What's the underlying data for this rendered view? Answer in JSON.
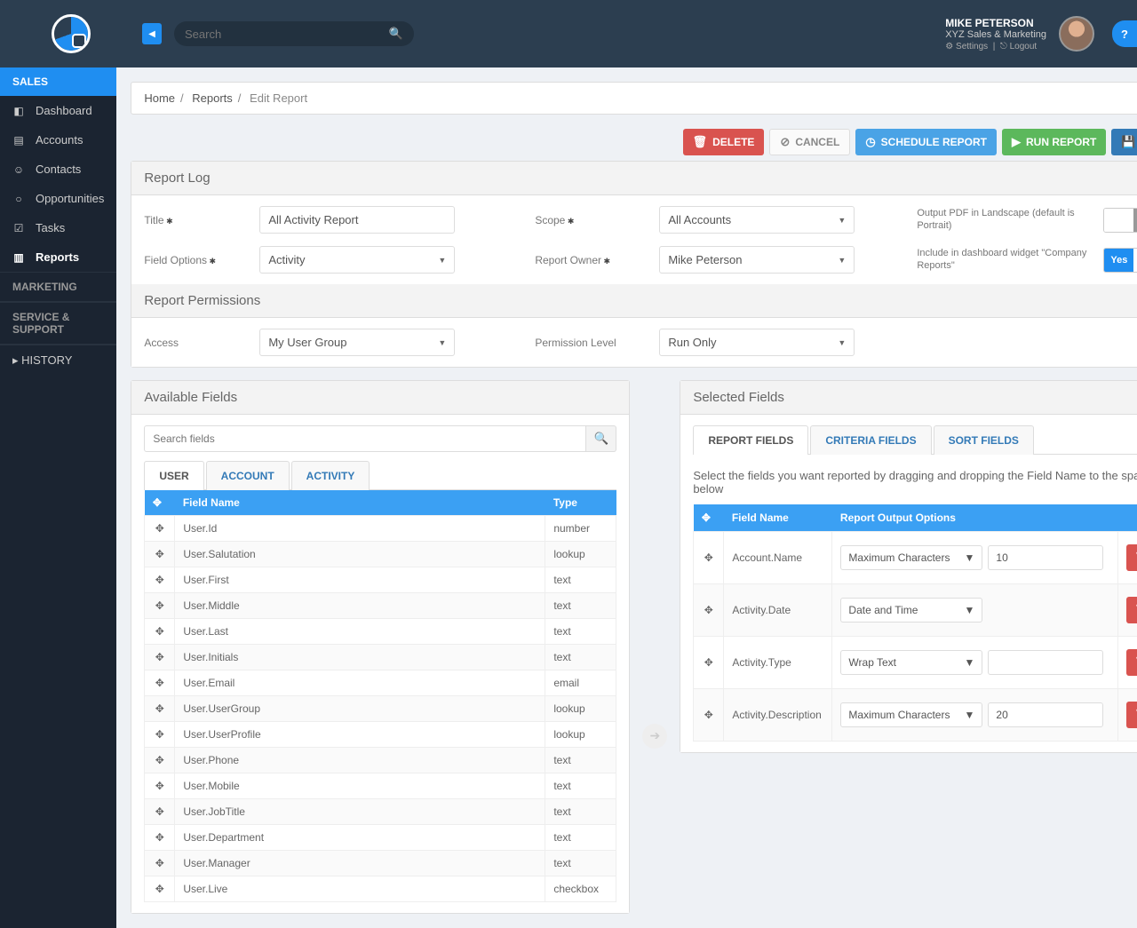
{
  "header": {
    "search_placeholder": "Search",
    "user_name": "MIKE PETERSON",
    "user_org": "XYZ Sales & Marketing",
    "settings": "Settings",
    "logout": "Logout",
    "help": "?"
  },
  "sidebar": {
    "sections": [
      {
        "label": "SALES",
        "items": [
          {
            "icon": "◧",
            "label": "Dashboard"
          },
          {
            "icon": "▤",
            "label": "Accounts"
          },
          {
            "icon": "☺",
            "label": "Contacts"
          },
          {
            "icon": "○",
            "label": "Opportunities"
          },
          {
            "icon": "☑",
            "label": "Tasks"
          },
          {
            "icon": "▥",
            "label": "Reports",
            "active": true
          }
        ]
      },
      {
        "label": "MARKETING",
        "dark": true
      },
      {
        "label": "SERVICE & SUPPORT",
        "dark": true
      }
    ],
    "history": "HISTORY"
  },
  "breadcrumb": [
    "Home",
    "Reports",
    "Edit Report"
  ],
  "actions": {
    "delete": "DELETE",
    "cancel": "CANCEL",
    "schedule": "SCHEDULE REPORT",
    "run": "RUN REPORT",
    "save": "SAVE"
  },
  "report_log": {
    "header": "Report Log",
    "labels": {
      "title": "Title",
      "field_options": "Field Options",
      "scope": "Scope",
      "owner": "Report Owner",
      "pdf": "Output PDF in Landscape (default is Portrait)",
      "dashboard": "Include in dashboard widget \"Company Reports\""
    },
    "title_value": "All Activity Report",
    "field_options_value": "Activity",
    "scope_value": "All Accounts",
    "owner_value": "Mike Peterson",
    "pdf_toggle": "No",
    "dash_toggle": "Yes"
  },
  "report_permissions": {
    "header": "Report Permissions",
    "labels": {
      "access": "Access",
      "level": "Permission Level"
    },
    "access_value": "My User Group",
    "level_value": "Run Only"
  },
  "available": {
    "header": "Available Fields",
    "search_placeholder": "Search fields",
    "tabs": [
      "USER",
      "ACCOUNT",
      "ACTIVITY"
    ],
    "cols": [
      "Field Name",
      "Type"
    ],
    "rows": [
      [
        "User.Id",
        "number"
      ],
      [
        "User.Salutation",
        "lookup"
      ],
      [
        "User.First",
        "text"
      ],
      [
        "User.Middle",
        "text"
      ],
      [
        "User.Last",
        "text"
      ],
      [
        "User.Initials",
        "text"
      ],
      [
        "User.Email",
        "email"
      ],
      [
        "User.UserGroup",
        "lookup"
      ],
      [
        "User.UserProfile",
        "lookup"
      ],
      [
        "User.Phone",
        "text"
      ],
      [
        "User.Mobile",
        "text"
      ],
      [
        "User.JobTitle",
        "text"
      ],
      [
        "User.Department",
        "text"
      ],
      [
        "User.Manager",
        "text"
      ],
      [
        "User.Live",
        "checkbox"
      ]
    ]
  },
  "selected": {
    "header": "Selected Fields",
    "tabs": [
      "REPORT FIELDS",
      "CRITERIA FIELDS",
      "SORT FIELDS"
    ],
    "hint": "Select the fields you want reported by dragging and dropping the Field Name to the space below",
    "cols": [
      "Field Name",
      "Report Output Options"
    ],
    "rows": [
      {
        "name": "Account.Name",
        "opt": "Maximum Characters",
        "val": "10"
      },
      {
        "name": "Activity.Date",
        "opt": "Date and Time",
        "val": ""
      },
      {
        "name": "Activity.Type",
        "opt": "Wrap Text",
        "val": ""
      },
      {
        "name": "Activity.Description",
        "opt": "Maximum Characters",
        "val": "20"
      }
    ]
  }
}
